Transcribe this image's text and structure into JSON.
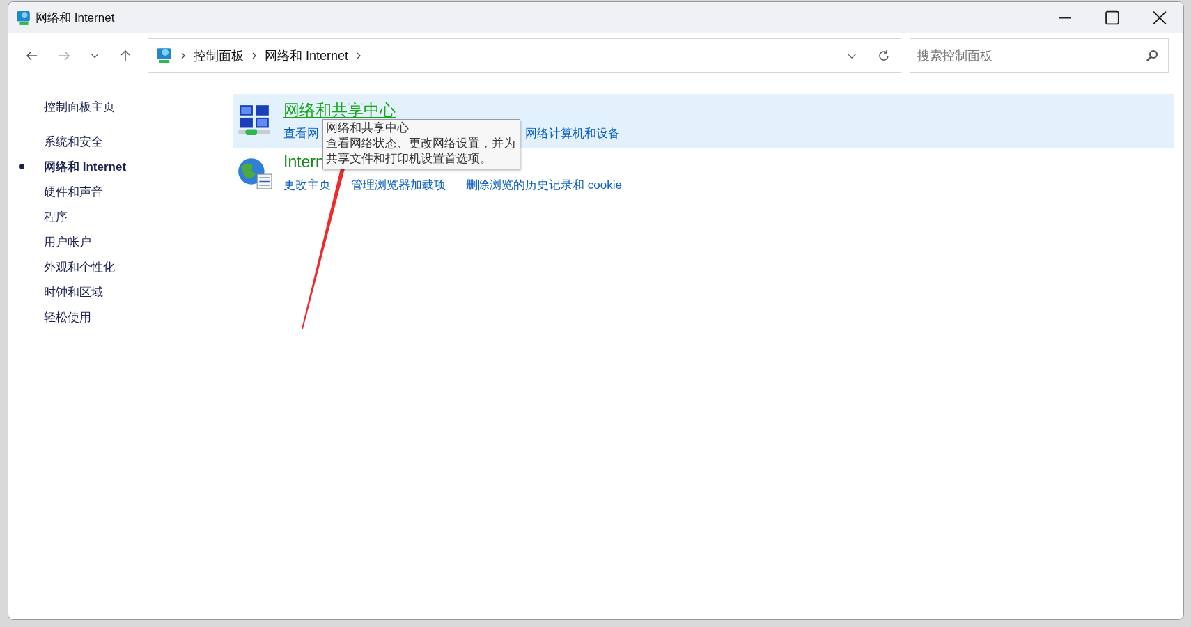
{
  "window": {
    "title": "网络和 Internet"
  },
  "breadcrumb": [
    {
      "label": "控制面板"
    },
    {
      "label": "网络和 Internet"
    }
  ],
  "search": {
    "placeholder": "搜索控制面板"
  },
  "sidebar": {
    "home": "控制面板主页",
    "items": [
      {
        "label": "系统和安全",
        "selected": false
      },
      {
        "label": "网络和 Internet",
        "selected": true
      },
      {
        "label": "硬件和声音",
        "selected": false
      },
      {
        "label": "程序",
        "selected": false
      },
      {
        "label": "用户帐户",
        "selected": false
      },
      {
        "label": "外观和个性化",
        "selected": false
      },
      {
        "label": "时钟和区域",
        "selected": false
      },
      {
        "label": "轻松使用",
        "selected": false
      }
    ]
  },
  "categories": [
    {
      "kind": "network",
      "title": "网络和共享中心",
      "hovered": true,
      "tasks": [
        {
          "label": "查看网"
        },
        {
          "label": "网络计算机和设备"
        }
      ],
      "tooltip": {
        "title": "网络和共享中心",
        "lines": [
          "查看网络状态、更改网络设置，并为",
          "共享文件和打印机设置首选项。"
        ]
      }
    },
    {
      "kind": "globe",
      "title": "Intern",
      "hovered": false,
      "tasks": [
        {
          "label": "更改主页"
        },
        {
          "label": "管理浏览器加载项"
        },
        {
          "label": "删除浏览的历史记录和 cookie"
        }
      ]
    }
  ]
}
